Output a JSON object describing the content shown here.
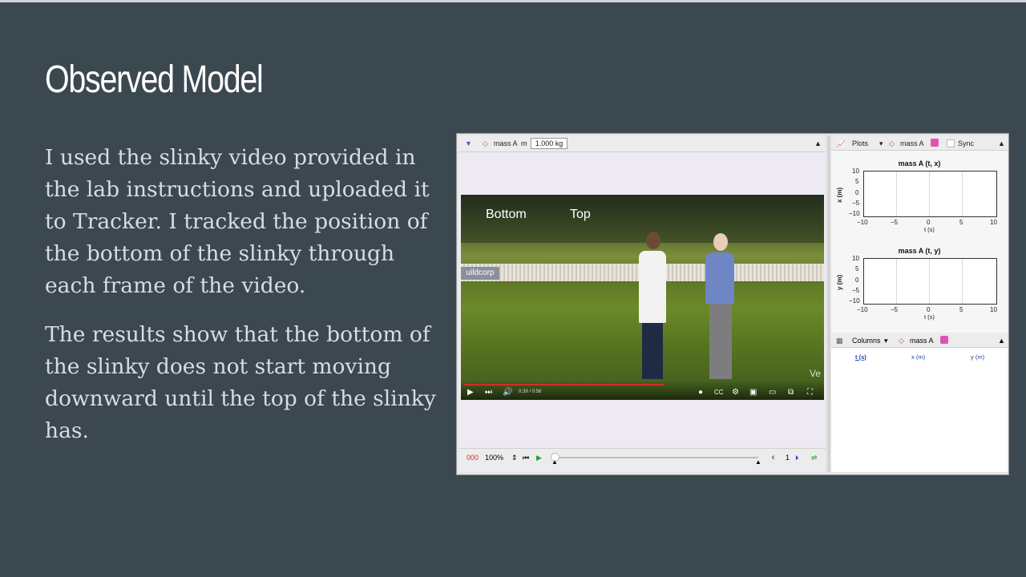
{
  "slide": {
    "title": "Observed Model",
    "paragraphs": [
      "I used the slinky video provided in the lab instructions and uploaded it to Tracker. I tracked the position of the bottom of the slinky through each frame of the video.",
      "The results show that the bottom of the slinky does not start moving downward until the top of the slinky has."
    ]
  },
  "tracker": {
    "video_toolbar": {
      "track_name": "mass A",
      "mass_label": "m",
      "mass_value": "1.000 kg"
    },
    "video": {
      "label_bottom": "Bottom",
      "label_top": "Top",
      "banner": "uildcorp",
      "time": "0:39 / 0:56",
      "watermark": "Ve"
    },
    "player": {
      "frame": "000",
      "zoom": "100%",
      "step": "1"
    },
    "plots_toolbar": {
      "plots_label": "Plots",
      "track_name": "mass A",
      "sync_label": "Sync"
    },
    "plots": [
      {
        "title": "mass A (t, x)",
        "ylabel": "x (m)",
        "xlabel": "t (s)",
        "yticks": [
          "10",
          "5",
          "0",
          "−5",
          "−10"
        ],
        "xticks": [
          "−10",
          "−5",
          "0",
          "5",
          "10"
        ]
      },
      {
        "title": "mass A (t, y)",
        "ylabel": "y (m)",
        "xlabel": "t (s)",
        "yticks": [
          "10",
          "5",
          "0",
          "−5",
          "−10"
        ],
        "xticks": [
          "−10",
          "−5",
          "0",
          "5",
          "10"
        ]
      }
    ],
    "table_toolbar": {
      "columns_label": "Columns",
      "track_name": "mass A"
    },
    "table_columns": [
      "t (s)",
      "x (m)",
      "y (m)"
    ],
    "colors": {
      "accent_pink": "#e052b4",
      "slide_bg": "#3b4850"
    }
  }
}
